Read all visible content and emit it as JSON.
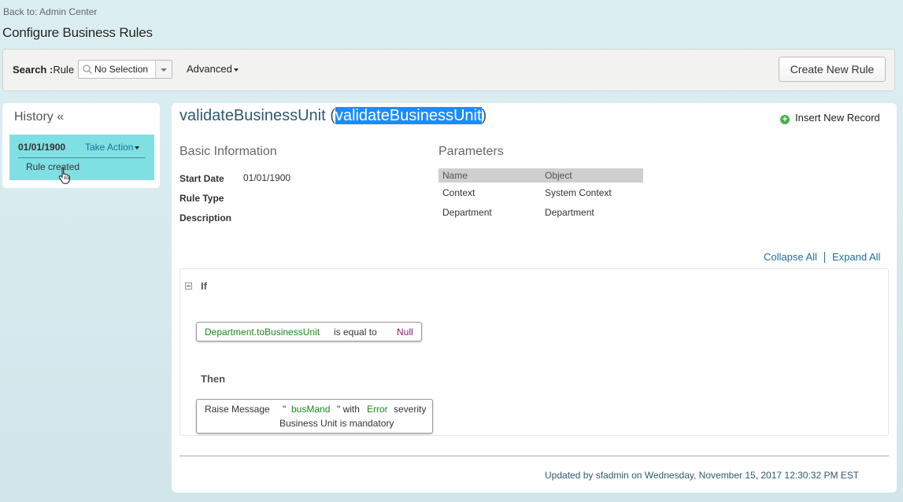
{
  "nav": {
    "back_link": "Back to: Admin Center"
  },
  "page": {
    "title": "Configure Business Rules"
  },
  "search": {
    "label": "Search :",
    "type_label": "Rule",
    "select_value": "No Selection",
    "advanced_label": "Advanced",
    "create_button": "Create New Rule"
  },
  "history": {
    "title": "History «",
    "entries": [
      {
        "date": "01/01/1900",
        "action_label": "Take Action",
        "description": "Rule created"
      }
    ]
  },
  "rule": {
    "name": "validateBusinessUnit",
    "title_open": " (",
    "id": "validateBusinessUnit",
    "title_close": ")",
    "insert_record": "Insert New Record",
    "basic_info": {
      "heading": "Basic Information",
      "start_date_label": "Start Date",
      "start_date": "01/01/1900",
      "rule_type_label": "Rule Type",
      "description_label": "Description"
    },
    "parameters": {
      "heading": "Parameters",
      "columns": [
        "Name",
        "Object"
      ],
      "rows": [
        {
          "name": "Context",
          "object": "System Context"
        },
        {
          "name": "Department",
          "object": "Department"
        }
      ]
    },
    "collapse_all": "Collapse All",
    "expand_all": "Expand All",
    "if_label": "If",
    "condition": {
      "field": "Department.toBusinessUnit",
      "operator": "is equal to",
      "value": "Null"
    },
    "then_label": "Then",
    "action": {
      "type": "Raise Message",
      "quote_open": "\"",
      "message_key": "busMand",
      "quote_with": "\" with",
      "severity": "Error",
      "severity_suffix": "severity",
      "message_text": "Business Unit is mandatory"
    },
    "footer": "Updated by sfadmin on Wednesday, November 15, 2017 12:30:32 PM EST"
  },
  "colors": {
    "accent": "#1f6f9a",
    "history_highlight": "#7fe0e4",
    "selection": "#1a8cff"
  },
  "icons": [
    "search-icon",
    "chevron-down-icon",
    "add-circle-icon",
    "collapse-icon",
    "hand-cursor-icon"
  ]
}
